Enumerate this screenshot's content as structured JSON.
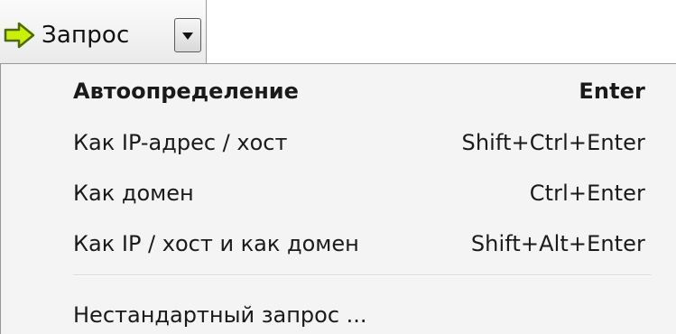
{
  "toolbar": {
    "query_button_label": "Запрос",
    "icons": {
      "query": "arrow-right-icon",
      "dropdown": "chevron-down-icon"
    },
    "colors": {
      "arrow_fill": "#c8f000",
      "arrow_stroke": "#4d6b00"
    }
  },
  "menu": {
    "items": [
      {
        "label": "Автоопределение",
        "shortcut": "Enter",
        "default": true
      },
      {
        "label": "Как IP-адрес / хост",
        "shortcut": "Shift+Ctrl+Enter"
      },
      {
        "label": "Как домен",
        "shortcut": "Ctrl+Enter"
      },
      {
        "label": "Как IP / хост и как домен",
        "shortcut": "Shift+Alt+Enter"
      }
    ],
    "custom_item": {
      "label": "Нестандартный запрос ..."
    }
  }
}
